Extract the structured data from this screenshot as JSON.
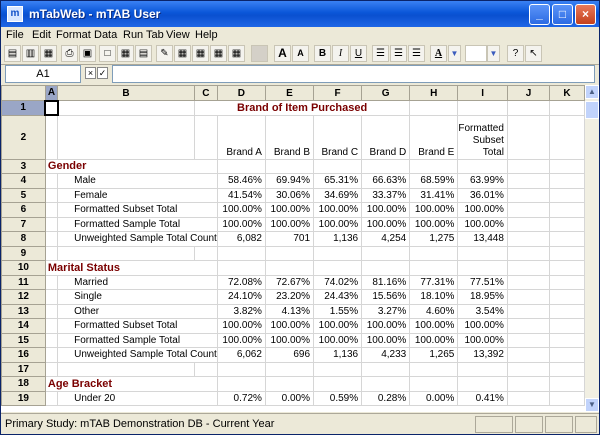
{
  "window": {
    "title": "mTabWeb - mTAB User",
    "app_icon": "mtab-app-icon"
  },
  "menu": [
    "File",
    "Edit",
    "Format",
    "Data",
    "Run Tab",
    "View",
    "Help"
  ],
  "toolbar": {
    "buttons": [
      "save-icon",
      "open-icon",
      "export-icon",
      "print-icon",
      "print-preview-icon",
      "frame-icon",
      "grid-lines-icon",
      "table-icon",
      "pencil-icon",
      "grid-a-icon",
      "grid-b-icon",
      "grid-c-icon",
      "grid-d-icon"
    ],
    "font_grow": "A",
    "font_shrink": "A",
    "bold": "B",
    "italic": "I",
    "underline": "U",
    "font_color": "A"
  },
  "formula_bar": {
    "cell_ref": "A1",
    "cancel": "×",
    "accept": "✓",
    "value": ""
  },
  "columns": [
    "A",
    "B",
    "C",
    "D",
    "E",
    "F",
    "G",
    "H",
    "I",
    "J",
    "K"
  ],
  "header_row": {
    "title": "Brand of Item Purchased",
    "brands": [
      "Brand A",
      "Brand B",
      "Brand C",
      "Brand D",
      "Brand E",
      "Formatted Subset Total"
    ]
  },
  "rows": [
    {
      "n": "3",
      "type": "section",
      "label": "Gender"
    },
    {
      "n": "4",
      "type": "data",
      "label": "Male",
      "values": [
        "58.46%",
        "69.94%",
        "65.31%",
        "66.63%",
        "68.59%",
        "63.99%"
      ]
    },
    {
      "n": "5",
      "type": "data",
      "label": "Female",
      "values": [
        "41.54%",
        "30.06%",
        "34.69%",
        "33.37%",
        "31.41%",
        "36.01%"
      ]
    },
    {
      "n": "6",
      "type": "data",
      "label": "Formatted Subset Total",
      "values": [
        "100.00%",
        "100.00%",
        "100.00%",
        "100.00%",
        "100.00%",
        "100.00%"
      ]
    },
    {
      "n": "7",
      "type": "data",
      "label": "Formatted Sample Total",
      "values": [
        "100.00%",
        "100.00%",
        "100.00%",
        "100.00%",
        "100.00%",
        "100.00%"
      ]
    },
    {
      "n": "8",
      "type": "data",
      "label": "Unweighted Sample Total Count",
      "values": [
        "6,082",
        "701",
        "1,136",
        "4,254",
        "1,275",
        "13,448"
      ]
    },
    {
      "n": "9",
      "type": "empty"
    },
    {
      "n": "10",
      "type": "section",
      "label": "Marital Status"
    },
    {
      "n": "11",
      "type": "data",
      "label": "Married",
      "values": [
        "72.08%",
        "72.67%",
        "74.02%",
        "81.16%",
        "77.31%",
        "77.51%"
      ]
    },
    {
      "n": "12",
      "type": "data",
      "label": "Single",
      "values": [
        "24.10%",
        "23.20%",
        "24.43%",
        "15.56%",
        "18.10%",
        "18.95%"
      ]
    },
    {
      "n": "13",
      "type": "data",
      "label": "Other",
      "values": [
        "3.82%",
        "4.13%",
        "1.55%",
        "3.27%",
        "4.60%",
        "3.54%"
      ]
    },
    {
      "n": "14",
      "type": "data",
      "label": "Formatted Subset Total",
      "values": [
        "100.00%",
        "100.00%",
        "100.00%",
        "100.00%",
        "100.00%",
        "100.00%"
      ]
    },
    {
      "n": "15",
      "type": "data",
      "label": "Formatted Sample Total",
      "values": [
        "100.00%",
        "100.00%",
        "100.00%",
        "100.00%",
        "100.00%",
        "100.00%"
      ]
    },
    {
      "n": "16",
      "type": "data",
      "label": "Unweighted Sample Total Count",
      "values": [
        "6,062",
        "696",
        "1,136",
        "4,233",
        "1,265",
        "13,392"
      ]
    },
    {
      "n": "17",
      "type": "empty"
    },
    {
      "n": "18",
      "type": "section",
      "label": "Age Bracket"
    },
    {
      "n": "19",
      "type": "data",
      "label": "Under 20",
      "values": [
        "0.72%",
        "0.00%",
        "0.59%",
        "0.28%",
        "0.00%",
        "0.41%"
      ]
    }
  ],
  "status": {
    "text": "Primary Study: mTAB Demonstration DB - Current Year"
  },
  "colors": {
    "section_text": "#7a0000",
    "title_bar": "#0a56d8",
    "selected_header": "#9aa6c6"
  }
}
